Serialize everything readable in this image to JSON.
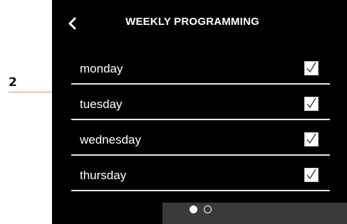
{
  "annotation": {
    "number": "2"
  },
  "header": {
    "title": "WEEKLY PROGRAMMING",
    "back_icon": "chevron-left-icon"
  },
  "days": [
    {
      "label": "monday",
      "checked": true
    },
    {
      "label": "tuesday",
      "checked": true
    },
    {
      "label": "wednesday",
      "checked": true
    },
    {
      "label": "thursday",
      "checked": true
    }
  ],
  "pager": {
    "current_page": 1,
    "total_pages": 2
  },
  "colors": {
    "screen_bg": "#000000",
    "text": "#ffffff",
    "callout": "#c9a25b",
    "pager_bar": "#3a3a3a"
  }
}
